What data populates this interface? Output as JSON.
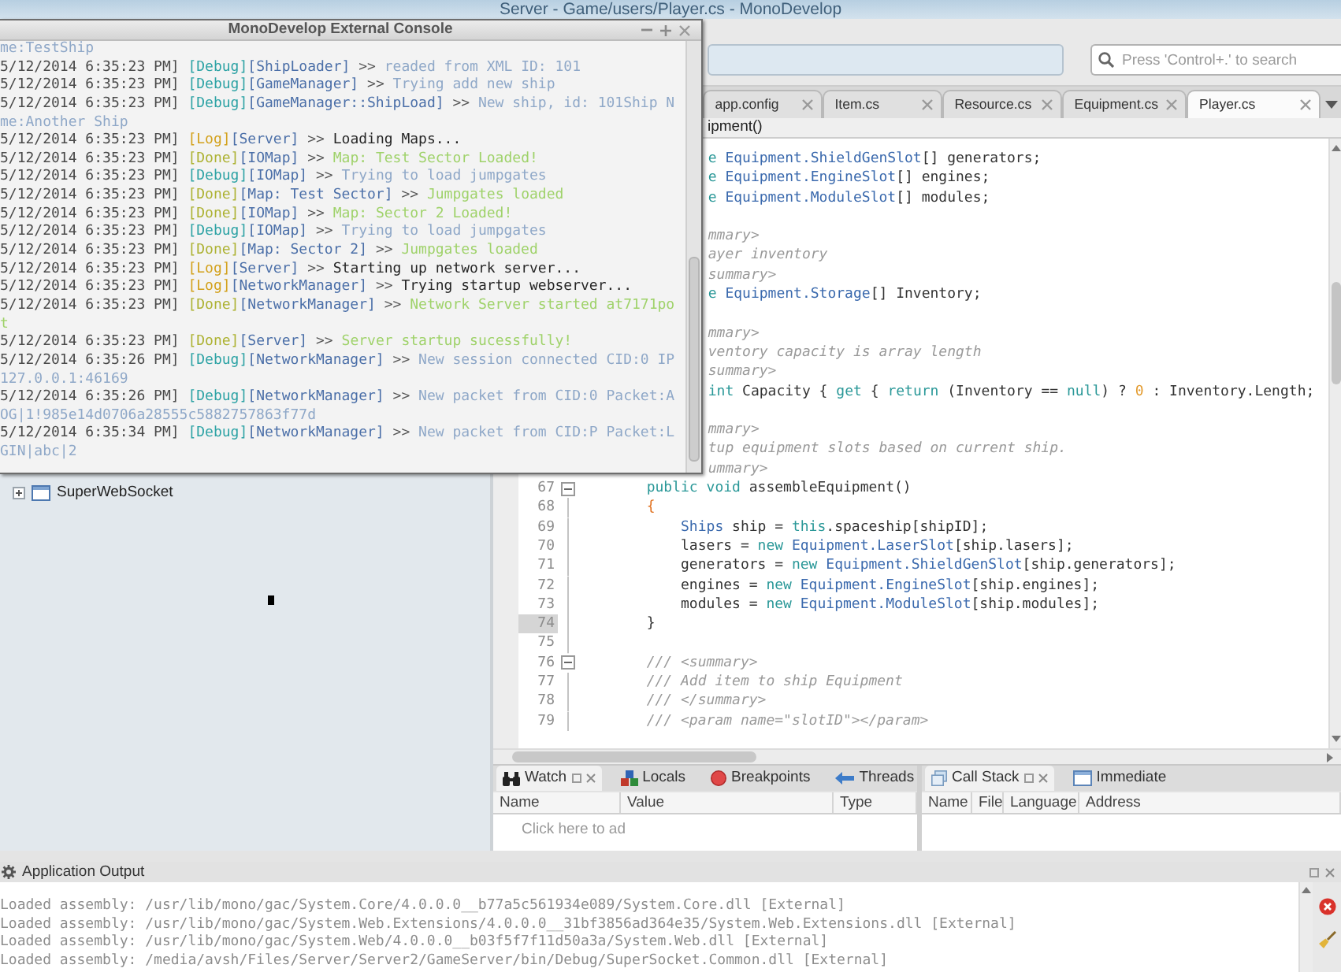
{
  "window": {
    "title": "Server - Game/users/Player.cs - MonoDevelop"
  },
  "console": {
    "title": "MonoDevelop External Console",
    "lines": [
      {
        "kind": "debug",
        "message": "me:TestShip"
      },
      {
        "kind": "debug",
        "time": "5/12/2014 6:35:23 PM]",
        "tag": "[Debug]",
        "source": "[ShipLoader]",
        "arrow": ">>",
        "message": "readed from XML ID: 101"
      },
      {
        "kind": "debug",
        "time": "5/12/2014 6:35:23 PM]",
        "tag": "[Debug]",
        "source": "[GameManager]",
        "arrow": ">>",
        "message": "Trying add new ship"
      },
      {
        "kind": "debug",
        "time": "5/12/2014 6:35:23 PM]",
        "tag": "[Debug]",
        "source": "[GameManager::ShipLoad]",
        "arrow": ">>",
        "message": "New ship, id: 101Ship N"
      },
      {
        "kind": "debug",
        "message": "me:Another Ship"
      },
      {
        "kind": "log",
        "time": "5/12/2014 6:35:23 PM]",
        "tag": "[Log]",
        "source": "[Server]",
        "arrow": ">>",
        "message": "Loading Maps..."
      },
      {
        "kind": "done",
        "time": "5/12/2014 6:35:23 PM]",
        "tag": "[Done]",
        "source": "[IOMap]",
        "arrow": ">>",
        "message": "Map: Test Sector Loaded!"
      },
      {
        "kind": "debug",
        "time": "5/12/2014 6:35:23 PM]",
        "tag": "[Debug]",
        "source": "[IOMap]",
        "arrow": ">>",
        "message": "Trying to load jumpgates"
      },
      {
        "kind": "done",
        "time": "5/12/2014 6:35:23 PM]",
        "tag": "[Done]",
        "source": "[Map: Test Sector]",
        "arrow": ">>",
        "message": "Jumpgates loaded"
      },
      {
        "kind": "done",
        "time": "5/12/2014 6:35:23 PM]",
        "tag": "[Done]",
        "source": "[IOMap]",
        "arrow": ">>",
        "message": "Map: Sector 2 Loaded!"
      },
      {
        "kind": "debug",
        "time": "5/12/2014 6:35:23 PM]",
        "tag": "[Debug]",
        "source": "[IOMap]",
        "arrow": ">>",
        "message": "Trying to load jumpgates"
      },
      {
        "kind": "done",
        "time": "5/12/2014 6:35:23 PM]",
        "tag": "[Done]",
        "source": "[Map: Sector 2]",
        "arrow": ">>",
        "message": "Jumpgates loaded"
      },
      {
        "kind": "log",
        "time": "5/12/2014 6:35:23 PM]",
        "tag": "[Log]",
        "source": "[Server]",
        "arrow": ">>",
        "message": "Starting up network server..."
      },
      {
        "kind": "log",
        "time": "5/12/2014 6:35:23 PM]",
        "tag": "[Log]",
        "source": "[NetworkManager]",
        "arrow": ">>",
        "message": "Trying startup webserver..."
      },
      {
        "kind": "done",
        "time": "5/12/2014 6:35:23 PM]",
        "tag": "[Done]",
        "source": "[NetworkManager]",
        "arrow": ">>",
        "message": "Network Server started at7171po"
      },
      {
        "kind": "done",
        "message": "t"
      },
      {
        "kind": "done",
        "time": "5/12/2014 6:35:23 PM]",
        "tag": "[Done]",
        "source": "[Server]",
        "arrow": ">>",
        "message": "Server startup sucessfully!"
      },
      {
        "kind": "debug",
        "time": "5/12/2014 6:35:26 PM]",
        "tag": "[Debug]",
        "source": "[NetworkManager]",
        "arrow": ">>",
        "message": "New session connected CID:0 IP"
      },
      {
        "kind": "debug",
        "message": "127.0.0.1:46169"
      },
      {
        "kind": "debug",
        "time": "5/12/2014 6:35:26 PM]",
        "tag": "[Debug]",
        "source": "[NetworkManager]",
        "arrow": ">>",
        "message": "New packet from CID:0 Packet:A"
      },
      {
        "kind": "debug",
        "message": "OG|1!985e14d0706a28555c5882757863f77d"
      },
      {
        "kind": "debug",
        "time": "5/12/2014 6:35:34 PM]",
        "tag": "[Debug]",
        "source": "[NetworkManager]",
        "arrow": ">>",
        "message": "New packet from CID:P Packet:L"
      },
      {
        "kind": "debug",
        "message": "GIN|abc|2"
      }
    ]
  },
  "toolbar": {
    "search": {
      "placeholder": "Press 'Control+.' to search"
    }
  },
  "editor": {
    "tabs": [
      {
        "label": "app.config",
        "selected": false
      },
      {
        "label": "Item.cs",
        "selected": false
      },
      {
        "label": "Resource.cs",
        "selected": false
      },
      {
        "label": "Equipment.cs",
        "selected": false
      },
      {
        "label": "Player.cs",
        "selected": true
      }
    ],
    "member": "ipment()",
    "partial_lines": [
      {
        "kind": "code",
        "tokens": [
          {
            "kind": "keyword",
            "text": "e "
          },
          {
            "kind": "type",
            "text": "Equipment.ShieldGenSlot"
          },
          {
            "kind": "plain",
            "text": "[] generators;"
          }
        ]
      },
      {
        "kind": "code",
        "tokens": [
          {
            "kind": "keyword",
            "text": "e "
          },
          {
            "kind": "type",
            "text": "Equipment.EngineSlot"
          },
          {
            "kind": "plain",
            "text": "[] engines;"
          }
        ]
      },
      {
        "kind": "code",
        "tokens": [
          {
            "kind": "keyword",
            "text": "e "
          },
          {
            "kind": "type",
            "text": "Equipment.ModuleSlot"
          },
          {
            "kind": "plain",
            "text": "[] modules;"
          }
        ]
      },
      {
        "kind": "blank"
      },
      {
        "kind": "code",
        "tokens": [
          {
            "kind": "comment",
            "text": "mmary>"
          }
        ]
      },
      {
        "kind": "code",
        "tokens": [
          {
            "kind": "comment",
            "text": "ayer inventory"
          }
        ]
      },
      {
        "kind": "code",
        "tokens": [
          {
            "kind": "comment",
            "text": "summary>"
          }
        ]
      },
      {
        "kind": "code",
        "tokens": [
          {
            "kind": "keyword",
            "text": "e "
          },
          {
            "kind": "type",
            "text": "Equipment.Storage"
          },
          {
            "kind": "plain",
            "text": "[] Inventory;"
          }
        ]
      },
      {
        "kind": "blank"
      },
      {
        "kind": "code",
        "tokens": [
          {
            "kind": "comment",
            "text": "mmary>"
          }
        ]
      },
      {
        "kind": "code",
        "tokens": [
          {
            "kind": "comment",
            "text": "ventory capacity is array length"
          }
        ]
      },
      {
        "kind": "code",
        "tokens": [
          {
            "kind": "comment",
            "text": "summary>"
          }
        ]
      },
      {
        "kind": "code",
        "tokens": [
          {
            "kind": "keyword",
            "text": "int"
          },
          {
            "kind": "plain",
            "text": " Capacity { "
          },
          {
            "kind": "keyword",
            "text": "get"
          },
          {
            "kind": "plain",
            "text": " { "
          },
          {
            "kind": "keyword",
            "text": "return"
          },
          {
            "kind": "plain",
            "text": " (Inventory == "
          },
          {
            "kind": "keyword",
            "text": "null"
          },
          {
            "kind": "plain",
            "text": ") ? "
          },
          {
            "kind": "number",
            "text": "0"
          },
          {
            "kind": "plain",
            "text": " : Inventory.Length;"
          }
        ]
      },
      {
        "kind": "blank"
      },
      {
        "kind": "code",
        "tokens": [
          {
            "kind": "comment",
            "text": "mmary>"
          }
        ]
      },
      {
        "kind": "code",
        "tokens": [
          {
            "kind": "comment",
            "text": "tup equipment slots based on current ship."
          }
        ]
      },
      {
        "kind": "code",
        "tokens": [
          {
            "kind": "comment",
            "text": "ummary>"
          }
        ]
      }
    ],
    "lines": [
      {
        "number": "67",
        "fold": true,
        "current": false,
        "tokens": [
          {
            "kind": "keyword",
            "text": "        public "
          },
          {
            "kind": "keyword",
            "text": "void"
          },
          {
            "kind": "plain",
            "text": " assembleEquipment()"
          }
        ]
      },
      {
        "number": "68",
        "fold": false,
        "current": false,
        "tokens": [
          {
            "kind": "brace",
            "text": "        {"
          }
        ]
      },
      {
        "number": "69",
        "fold": false,
        "current": false,
        "tokens": [
          {
            "kind": "type",
            "text": "            Ships"
          },
          {
            "kind": "plain",
            "text": " ship = "
          },
          {
            "kind": "keyword",
            "text": "this"
          },
          {
            "kind": "plain",
            "text": ".spaceship[shipID];"
          }
        ]
      },
      {
        "number": "70",
        "fold": false,
        "current": false,
        "tokens": [
          {
            "kind": "plain",
            "text": "            lasers = "
          },
          {
            "kind": "keyword",
            "text": "new "
          },
          {
            "kind": "type",
            "text": "Equipment.LaserSlot"
          },
          {
            "kind": "plain",
            "text": "[ship.lasers];"
          }
        ]
      },
      {
        "number": "71",
        "fold": false,
        "current": false,
        "tokens": [
          {
            "kind": "plain",
            "text": "            generators = "
          },
          {
            "kind": "keyword",
            "text": "new "
          },
          {
            "kind": "type",
            "text": "Equipment.ShieldGenSlot"
          },
          {
            "kind": "plain",
            "text": "[ship.generators];"
          }
        ]
      },
      {
        "number": "72",
        "fold": false,
        "current": false,
        "tokens": [
          {
            "kind": "plain",
            "text": "            engines = "
          },
          {
            "kind": "keyword",
            "text": "new "
          },
          {
            "kind": "type",
            "text": "Equipment.EngineSlot"
          },
          {
            "kind": "plain",
            "text": "[ship.engines];"
          }
        ]
      },
      {
        "number": "73",
        "fold": false,
        "current": false,
        "tokens": [
          {
            "kind": "plain",
            "text": "            modules = "
          },
          {
            "kind": "keyword",
            "text": "new "
          },
          {
            "kind": "type",
            "text": "Equipment.ModuleSlot"
          },
          {
            "kind": "plain",
            "text": "[ship.modules];"
          }
        ]
      },
      {
        "number": "74",
        "fold": false,
        "current": true,
        "tokens": [
          {
            "kind": "plain",
            "text": "        }"
          }
        ]
      },
      {
        "number": "75",
        "fold": false,
        "current": false
      },
      {
        "number": "76",
        "fold": true,
        "current": false,
        "tokens": [
          {
            "kind": "comment",
            "text": "        /// <summary>"
          }
        ]
      },
      {
        "number": "77",
        "fold": false,
        "current": false,
        "tokens": [
          {
            "kind": "comment",
            "text": "        /// Add item to ship Equipment"
          }
        ]
      },
      {
        "number": "78",
        "fold": false,
        "current": false,
        "tokens": [
          {
            "kind": "comment",
            "text": "        /// </summary>"
          }
        ]
      },
      {
        "number": "79",
        "fold": false,
        "current": false,
        "tokens": [
          {
            "kind": "comment",
            "text": "        /// <param name=\"slotID\"></param>"
          }
        ]
      }
    ]
  },
  "solution": {
    "items": [
      {
        "label": "SuperWebSocket",
        "expanded": false
      }
    ]
  },
  "debug_pads": {
    "watch": {
      "tabs": [
        {
          "label": "Watch",
          "kind": "watch",
          "selected": true
        },
        {
          "label": "Locals",
          "kind": "locals",
          "selected": false
        },
        {
          "label": "Breakpoints",
          "kind": "breakpoints",
          "selected": false
        },
        {
          "label": "Threads",
          "kind": "threads",
          "selected": false
        }
      ],
      "columns": [
        "Name",
        "Value",
        "Type"
      ],
      "hint_row": "Click here to ad"
    },
    "call_stack": {
      "tabs": [
        {
          "label": "Call Stack",
          "kind": "call_stack",
          "selected": true
        },
        {
          "label": "Immediate",
          "kind": "immediate",
          "selected": false
        }
      ],
      "columns": [
        "Name",
        "File",
        "Language",
        "Address"
      ]
    }
  },
  "application_output": {
    "title": "Application Output",
    "lines": [
      "Loaded assembly: /usr/lib/mono/gac/System.Core/4.0.0.0__b77a5c561934e089/System.Core.dll [External]",
      "Loaded assembly: /usr/lib/mono/gac/System.Web.Extensions/4.0.0.0__31bf3856ad364e35/System.Web.Extensions.dll [External]",
      "Loaded assembly: /usr/lib/mono/gac/System.Web/4.0.0.0__b03f5f7f11d50a3a/System.Web.dll [External]",
      "Loaded assembly: /media/avsh/Files/Server/Server2/GameServer/bin/Debug/SuperSocket.Common.dll [External]"
    ]
  }
}
